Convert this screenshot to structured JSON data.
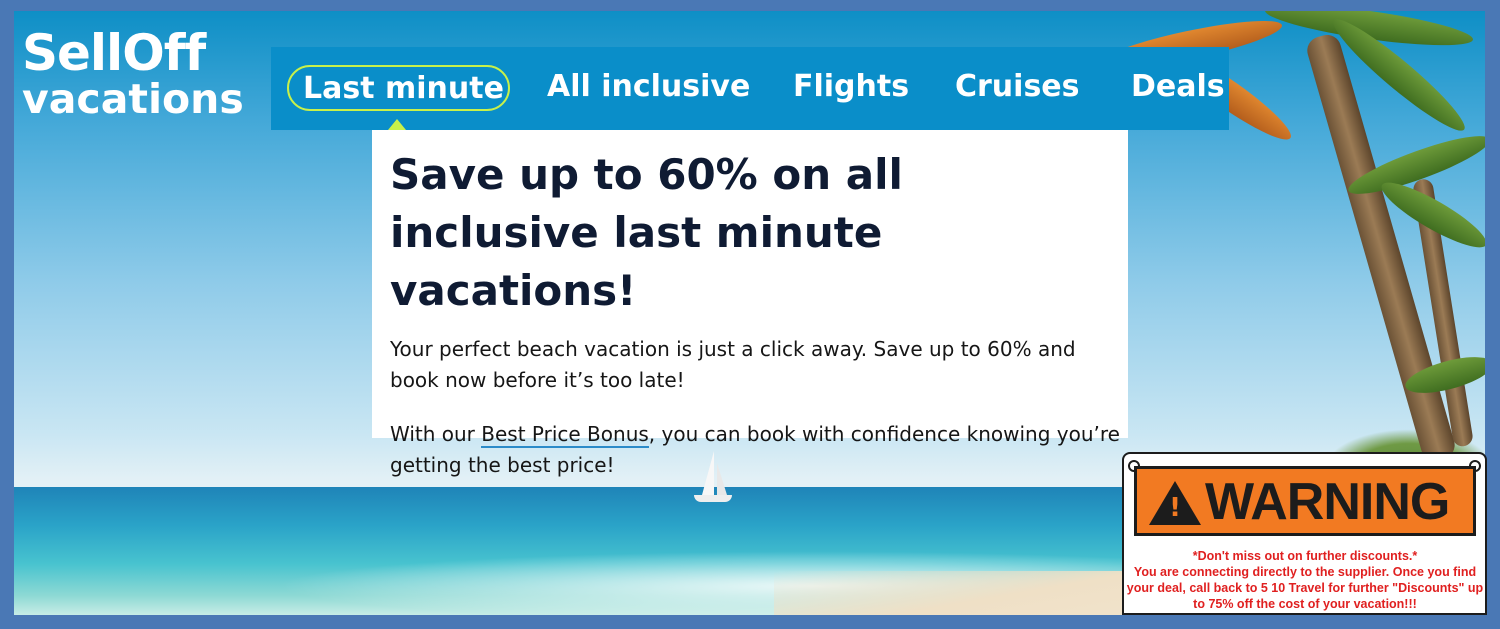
{
  "logo": {
    "line1": "SellOff",
    "line2": "vacations"
  },
  "nav": {
    "items": [
      {
        "label": "Last minute",
        "active": true
      },
      {
        "label": "All inclusive"
      },
      {
        "label": "Flights"
      },
      {
        "label": "Cruises"
      },
      {
        "label": "Deals"
      }
    ]
  },
  "hero": {
    "headline": "Save up to 60% on all inclusive last minute vacations!",
    "paragraph1": "Your perfect beach vacation is just a click away. Save up to 60% and book now before it’s too late!",
    "paragraph2_prefix": "With our ",
    "paragraph2_link": "Best Price Bonus",
    "paragraph2_suffix": ", you can book with confidence knowing you’re getting the best price!"
  },
  "warning": {
    "title": "WARNING",
    "line1": "*Don't miss out on further discounts.*",
    "line2": "You are connecting directly to the supplier. Once you find your deal, call back to 5 10 Travel for further \"Discounts\" up to 75% off the cost of your vacation!!!"
  },
  "colors": {
    "nav_bg": "#0a8ec9",
    "active_outline": "#c8f14a",
    "headline": "#0f1b33",
    "link_underline": "#2c8bc9",
    "warning_orange": "#f27a22",
    "warning_text": "#e02020"
  }
}
